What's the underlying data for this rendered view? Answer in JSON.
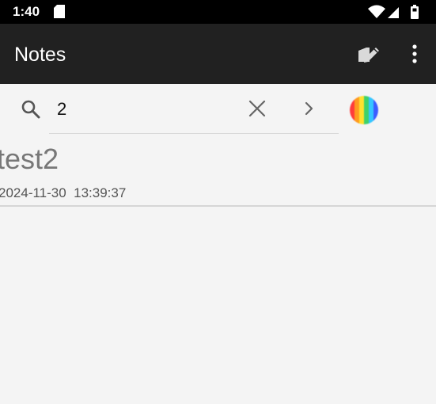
{
  "status_bar": {
    "time": "1:40",
    "icons": [
      "sd-card-icon",
      "wifi-icon",
      "signal-icon",
      "battery-icon"
    ]
  },
  "app_bar": {
    "title": "Notes",
    "icons": [
      "edit-note-icon",
      "more-vert-icon"
    ],
    "background": "#212121"
  },
  "search": {
    "value": "2",
    "placeholder": "",
    "icons": [
      "search-icon",
      "close-icon",
      "chevron-right-icon",
      "color-picker-icon"
    ]
  },
  "notes": [
    {
      "title": "test2",
      "date": "2024-11-30  13:39:37"
    }
  ],
  "colors": {
    "status_bar": "#000000",
    "background": "#f4f4f4",
    "note_title": "#777777",
    "rainbow": [
      "#ff3b3b",
      "#ff9a1f",
      "#ffe12e",
      "#3fd16b",
      "#34c6ff",
      "#3b5bff",
      "#a649ff"
    ]
  }
}
